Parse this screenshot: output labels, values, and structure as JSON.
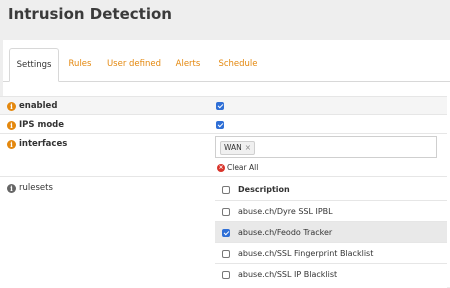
{
  "header": {
    "title": "Intrusion Detection"
  },
  "tabs": [
    {
      "label": "Settings",
      "active": true
    },
    {
      "label": "Rules"
    },
    {
      "label": "User defined"
    },
    {
      "label": "Alerts"
    },
    {
      "label": "Schedule"
    }
  ],
  "settings": {
    "enabled": {
      "label": "enabled",
      "checked": true
    },
    "ips_mode": {
      "label": "IPS mode",
      "checked": true
    },
    "interfaces": {
      "label": "interfaces",
      "selected": [
        "WAN"
      ],
      "clear_all": "Clear All"
    },
    "rulesets": {
      "label": "rulesets",
      "header": "Description",
      "items": [
        {
          "label": "abuse.ch/Dyre SSL IPBL",
          "checked": false
        },
        {
          "label": "abuse.ch/Feodo Tracker",
          "checked": true
        },
        {
          "label": "abuse.ch/SSL Fingerprint Blacklist",
          "checked": false
        },
        {
          "label": "abuse.ch/SSL IP Blacklist",
          "checked": false
        }
      ]
    }
  },
  "colors": {
    "accent": "#e4880e",
    "checkbox": "#2f6fd6",
    "clear_icon": "#d9342b"
  }
}
